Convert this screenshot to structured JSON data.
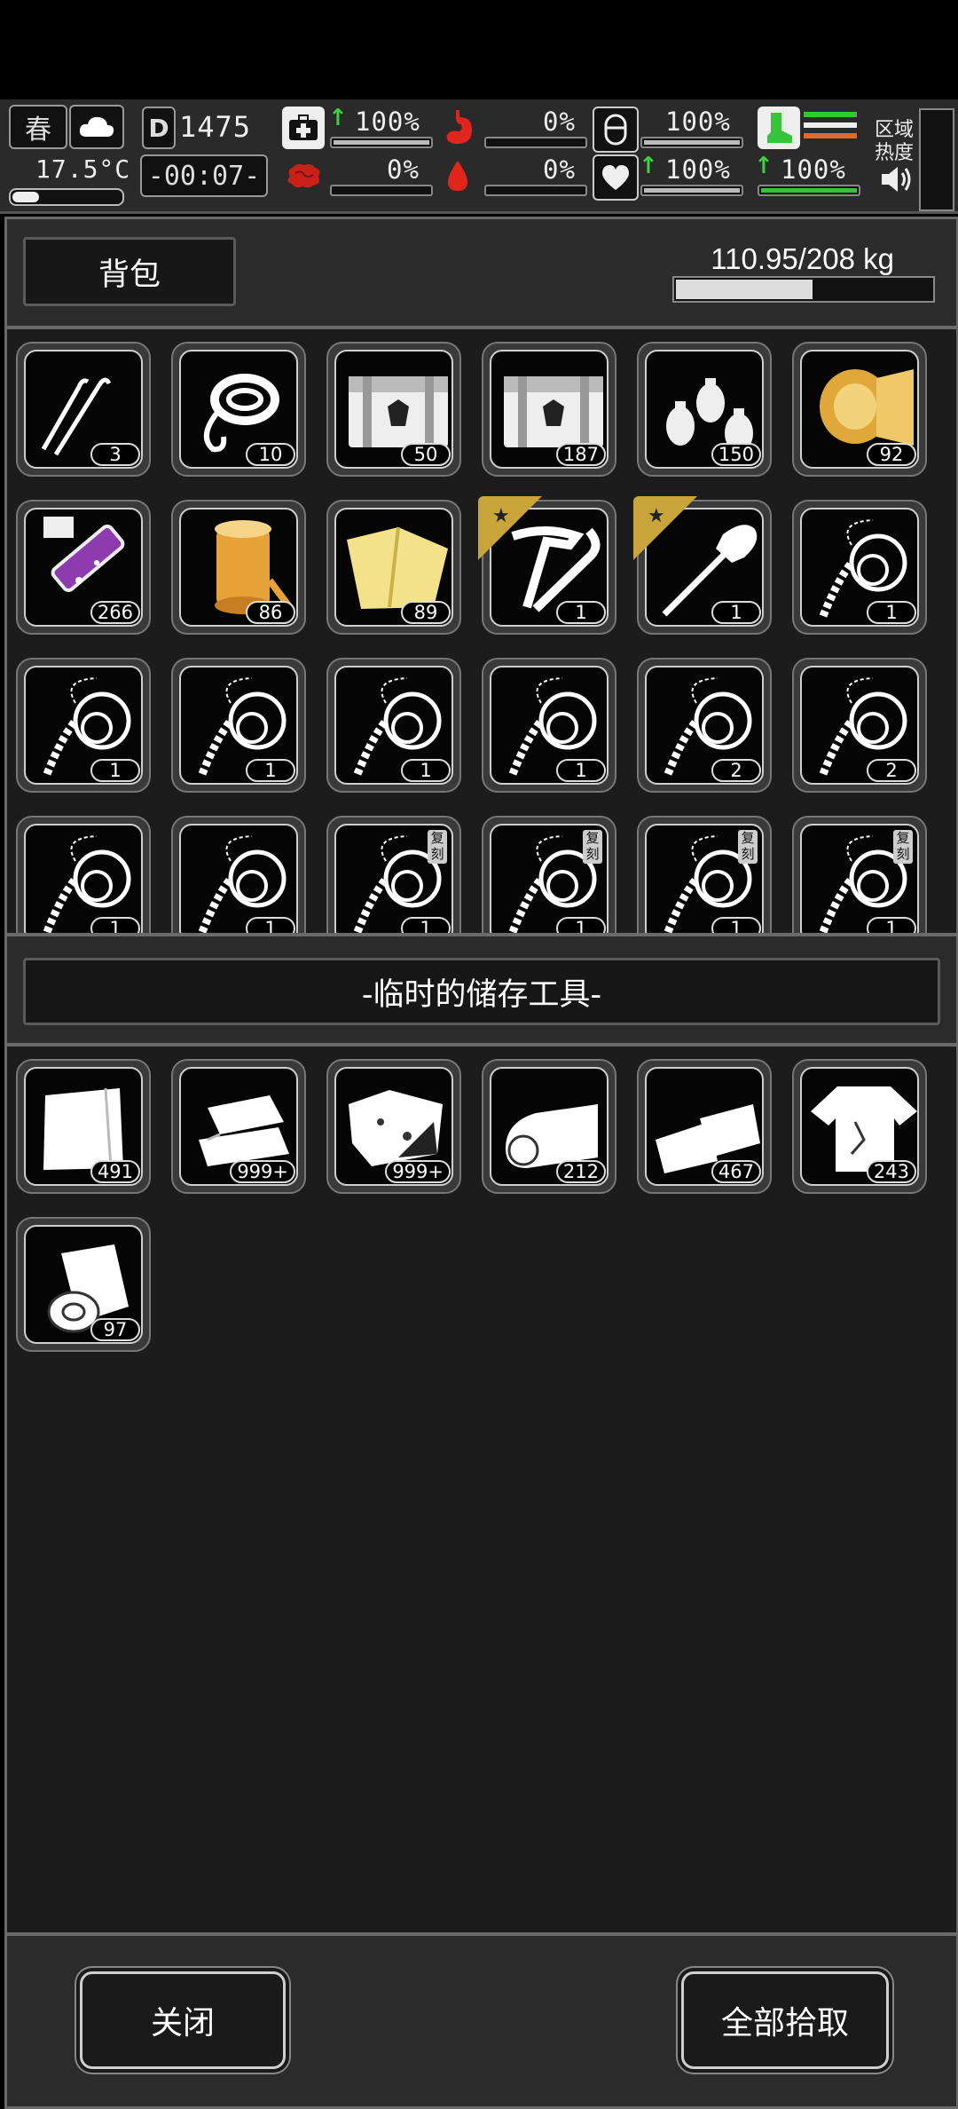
{
  "hud": {
    "season": "春",
    "temperature": "17.5°C",
    "day_counter": "1475",
    "clock": "-00:07-",
    "stats": {
      "health": "100%",
      "hunger": "0%",
      "armor": "100%",
      "brain": "0%",
      "blood": "0%",
      "heart": "100%",
      "stamina": "100%"
    },
    "zone_label_1": "区域",
    "zone_label_2": "热度"
  },
  "backpack": {
    "title": "背包",
    "weight": "110.95/208 kg",
    "weight_fraction": 0.533,
    "items": [
      {
        "icon": "lockpick-icon",
        "count": "3"
      },
      {
        "icon": "rope-coil-icon",
        "count": "10"
      },
      {
        "icon": "supply-crate-icon",
        "count": "50"
      },
      {
        "icon": "supply-crate-icon",
        "count": "187"
      },
      {
        "icon": "grenades-icon",
        "count": "150"
      },
      {
        "icon": "fabric-roll-icon",
        "count": "92"
      },
      {
        "icon": "chemical-tube-icon",
        "count": "266"
      },
      {
        "icon": "thread-spool-icon",
        "count": "86"
      },
      {
        "icon": "cloth-sheet-icon",
        "count": "89"
      },
      {
        "icon": "tool-kit-icon",
        "count": "1",
        "rare": true
      },
      {
        "icon": "shovel-icon",
        "count": "1",
        "rare": true
      },
      {
        "icon": "whip-icon",
        "count": "1"
      },
      {
        "icon": "whip-icon",
        "count": "1"
      },
      {
        "icon": "whip-icon",
        "count": "1"
      },
      {
        "icon": "whip-icon",
        "count": "1"
      },
      {
        "icon": "whip-icon",
        "count": "1"
      },
      {
        "icon": "whip-icon",
        "count": "2"
      },
      {
        "icon": "whip-icon",
        "count": "2"
      },
      {
        "icon": "whip-icon",
        "count": "1"
      },
      {
        "icon": "whip-icon",
        "count": "1"
      },
      {
        "icon": "whip-icon",
        "count": "1",
        "tag": "复刻"
      },
      {
        "icon": "whip-icon",
        "count": "1",
        "tag": "复刻"
      },
      {
        "icon": "whip-icon",
        "count": "1",
        "tag": "复刻"
      },
      {
        "icon": "whip-icon",
        "count": "1",
        "tag": "复刻"
      }
    ]
  },
  "storage": {
    "title": "-临时的储存工具-",
    "items": [
      {
        "icon": "cloth-icon",
        "count": "491"
      },
      {
        "icon": "folded-clothes-icon",
        "count": "999+"
      },
      {
        "icon": "torn-rag-icon",
        "count": "999+"
      },
      {
        "icon": "fabric-bolt-icon",
        "count": "212"
      },
      {
        "icon": "cloth-strips-icon",
        "count": "467"
      },
      {
        "icon": "torn-shirt-icon",
        "count": "243"
      },
      {
        "icon": "bandage-roll-icon",
        "count": "97"
      }
    ]
  },
  "footer": {
    "close_label": "关闭",
    "pickup_all_label": "全部拾取"
  }
}
